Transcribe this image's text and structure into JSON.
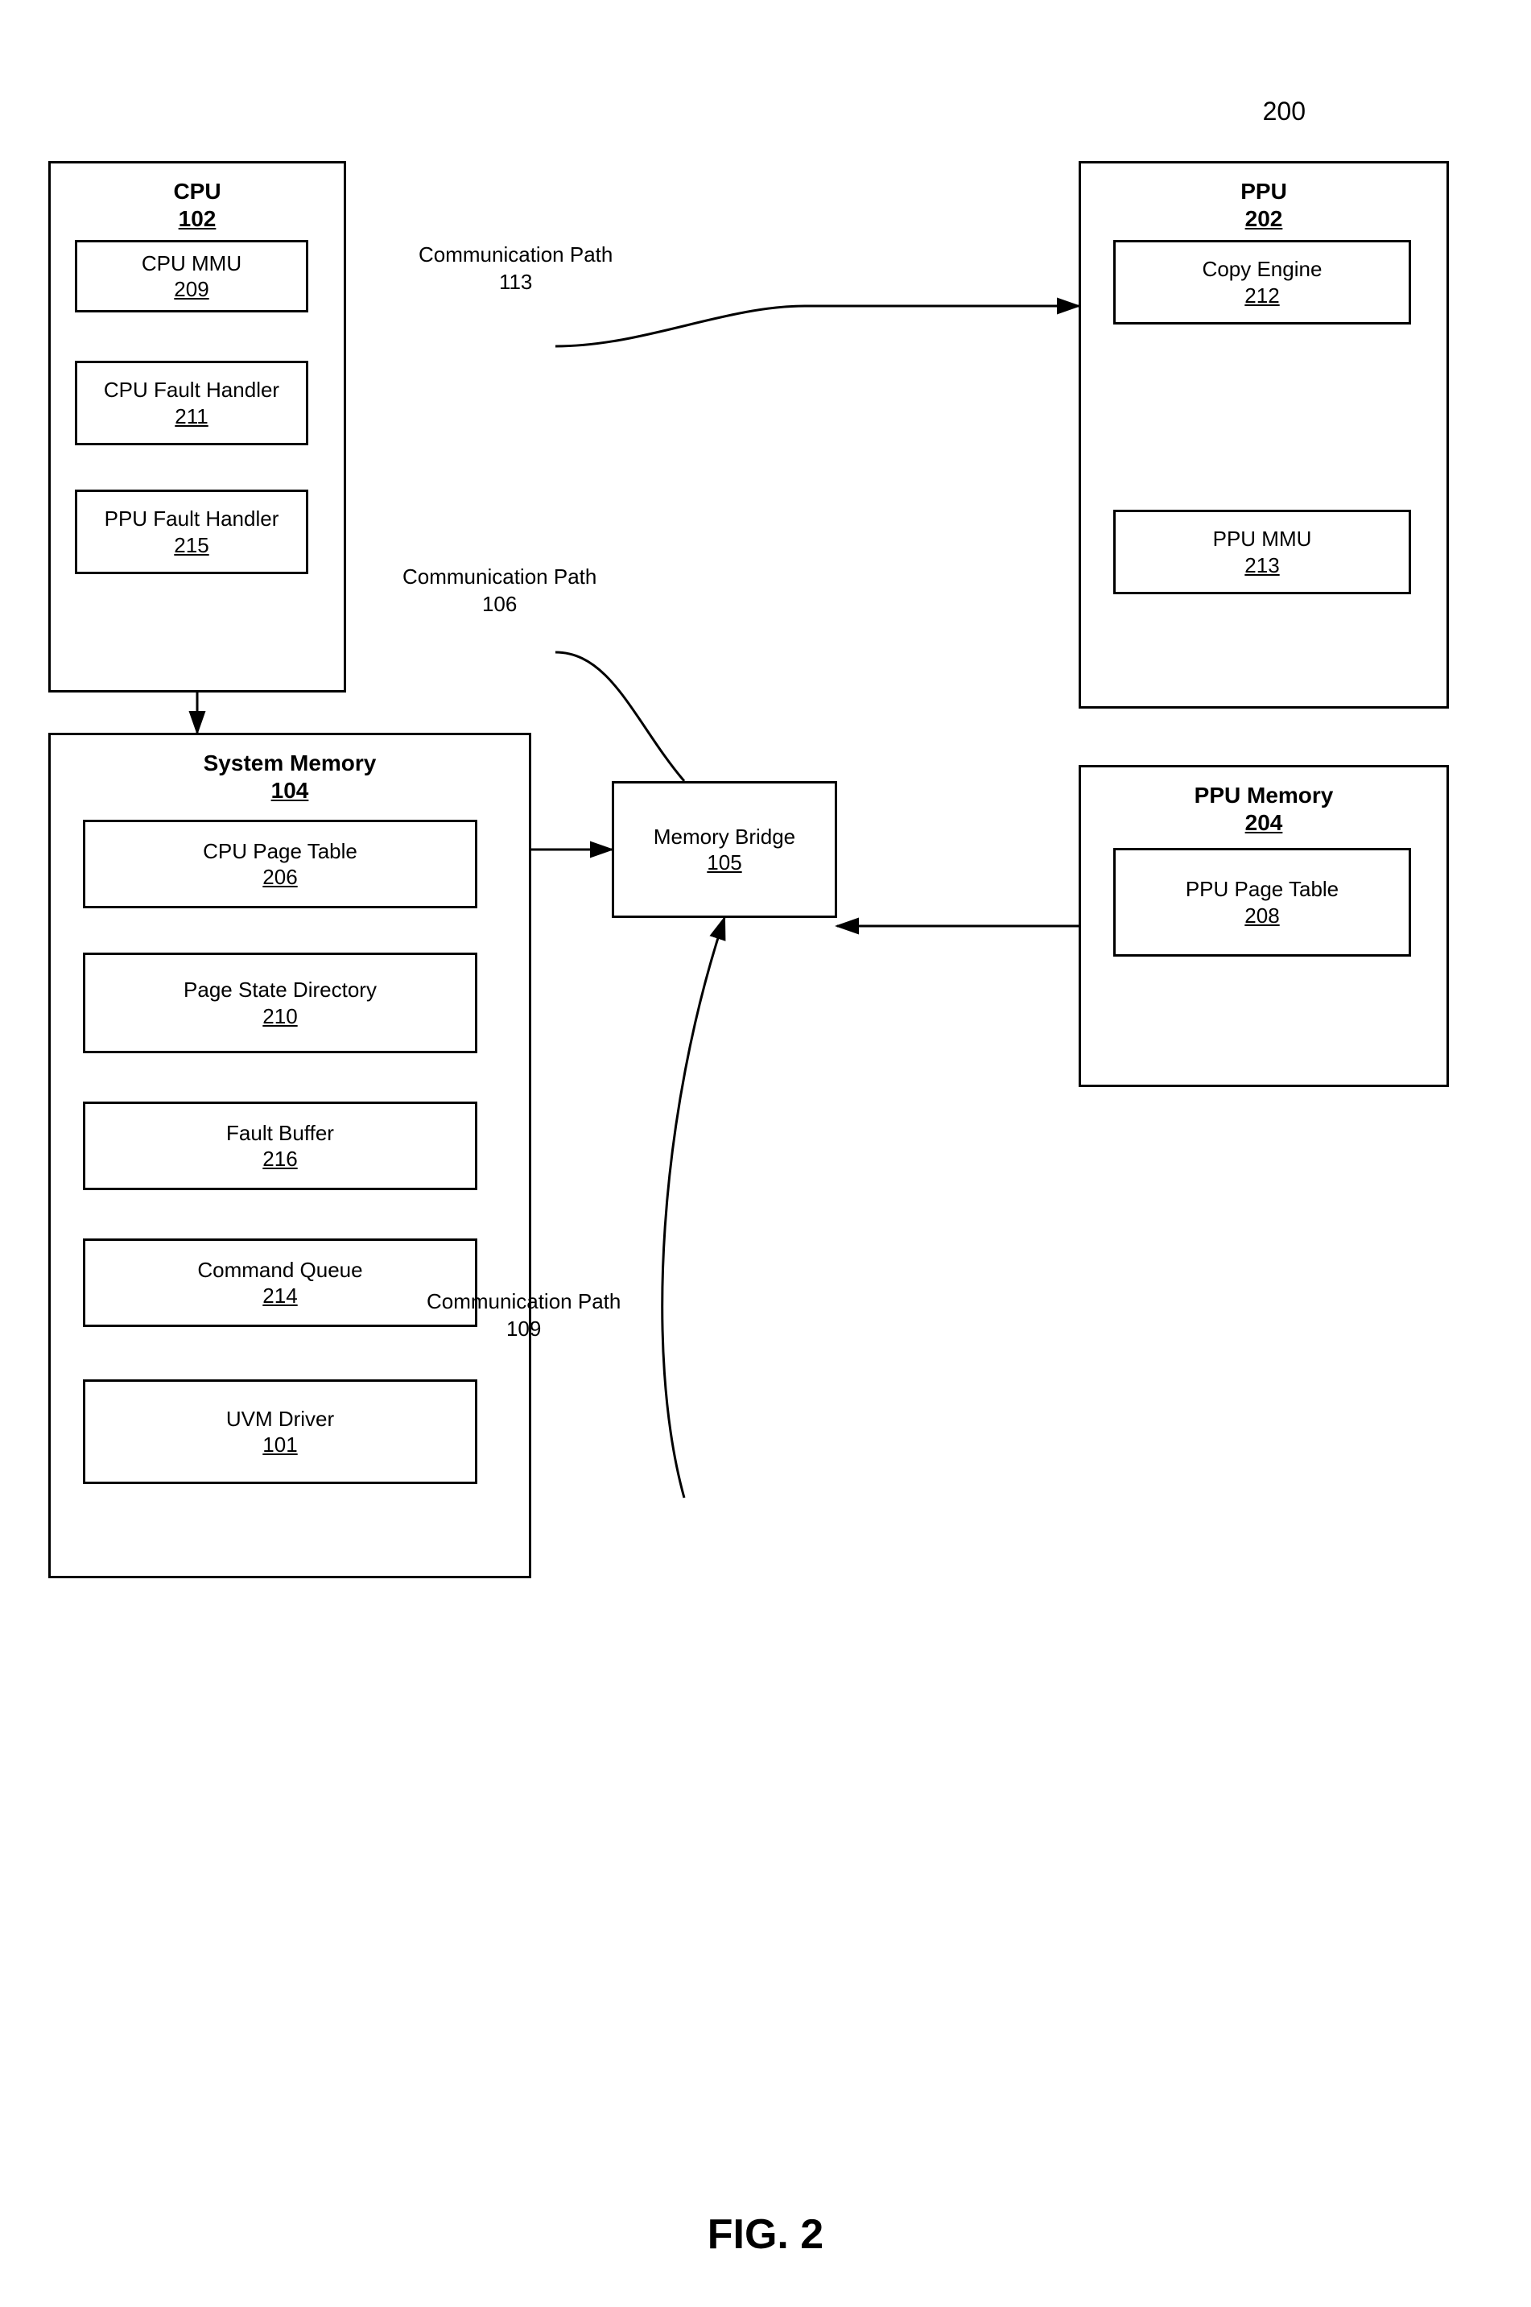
{
  "diagram": {
    "ref": "200",
    "fig": "FIG. 2",
    "cpu_box": {
      "label": "CPU",
      "num": "102"
    },
    "cpu_mmu": {
      "label": "CPU MMU",
      "num": "209"
    },
    "cpu_fault": {
      "label": "CPU Fault Handler",
      "num": "211"
    },
    "ppu_fault": {
      "label": "PPU Fault Handler",
      "num": "215"
    },
    "ppu_box": {
      "label": "PPU",
      "num": "202"
    },
    "copy_engine": {
      "label": "Copy Engine",
      "num": "212"
    },
    "ppu_mmu": {
      "label": "PPU MMU",
      "num": "213"
    },
    "memory_bridge": {
      "label": "Memory Bridge",
      "num": "105"
    },
    "sys_memory": {
      "label": "System Memory",
      "num": "104"
    },
    "cpu_page_table": {
      "label": "CPU Page Table",
      "num": "206"
    },
    "page_state_dir": {
      "label": "Page State Directory",
      "num": "210"
    },
    "fault_buffer": {
      "label": "Fault Buffer",
      "num": "216"
    },
    "command_queue": {
      "label": "Command Queue",
      "num": "214"
    },
    "uvm_driver": {
      "label": "UVM Driver",
      "num": "101"
    },
    "ppu_memory": {
      "label": "PPU Memory",
      "num": "204"
    },
    "ppu_page_table": {
      "label": "PPU Page Table",
      "num": "208"
    },
    "comm_path_113": {
      "label": "Communication Path",
      "num": "113"
    },
    "comm_path_106": {
      "label": "Communication Path",
      "num": "106"
    },
    "comm_path_109": {
      "label": "Communication Path",
      "num": "109"
    }
  }
}
